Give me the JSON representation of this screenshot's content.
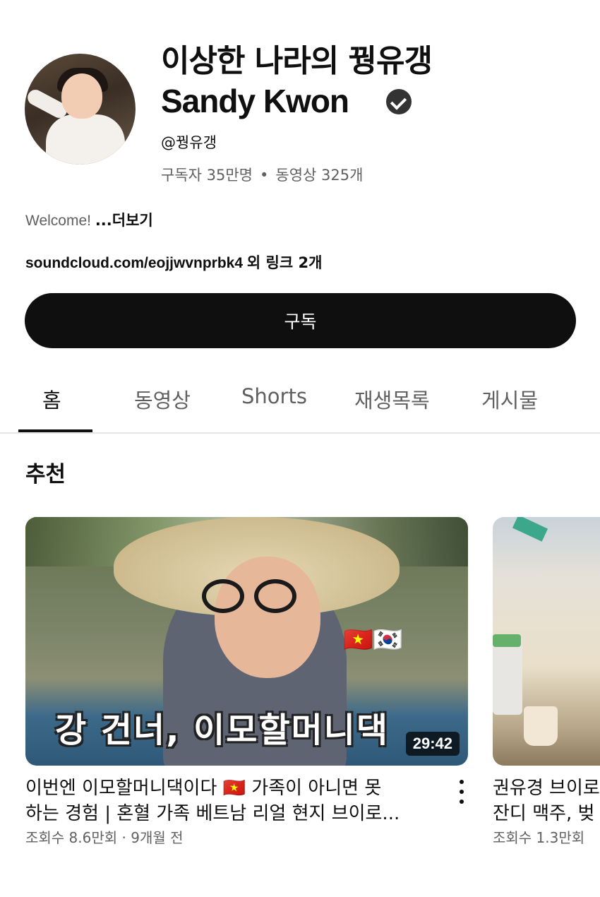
{
  "channel": {
    "name_korean": "이상한 나라의 꿩유갱",
    "name_english": "Sandy Kwon",
    "verified_icon": "verified-check-icon",
    "handle": "@꿩유갱",
    "subscribers": "구독자 35만명",
    "separator": "•",
    "video_count": "동영상 325개",
    "description": "Welcome!",
    "more_label": "...더보기",
    "link": "soundcloud.com/eojjwvnprbk4",
    "extra_links": "외 링크 2개",
    "subscribe_label": "구독"
  },
  "tabs": [
    {
      "label": "홈",
      "active": true
    },
    {
      "label": "동영상",
      "active": false
    },
    {
      "label": "Shorts",
      "active": false
    },
    {
      "label": "재생목록",
      "active": false
    },
    {
      "label": "게시물",
      "active": false
    }
  ],
  "section": {
    "title": "추천"
  },
  "videos": [
    {
      "thumbnail_caption": "강 건너, 이모할머니댁",
      "thumbnail_flags": "🇻🇳🇰🇷",
      "duration": "29:42",
      "title_line1": "이번엔 이모할머니댁이다 🇻🇳 가족이 아니면 못",
      "title_line2": "하는 경험 | 혼혈 가족 베트남 리얼 현지 브이로...",
      "meta": "조회수 8.6만회 · 9개월 전",
      "menu_icon": "more-vert-icon"
    },
    {
      "title_line1": "권유경 브이로",
      "title_line2": "잔디 맥주, 벚",
      "meta": "조회수 1.3만회"
    }
  ]
}
